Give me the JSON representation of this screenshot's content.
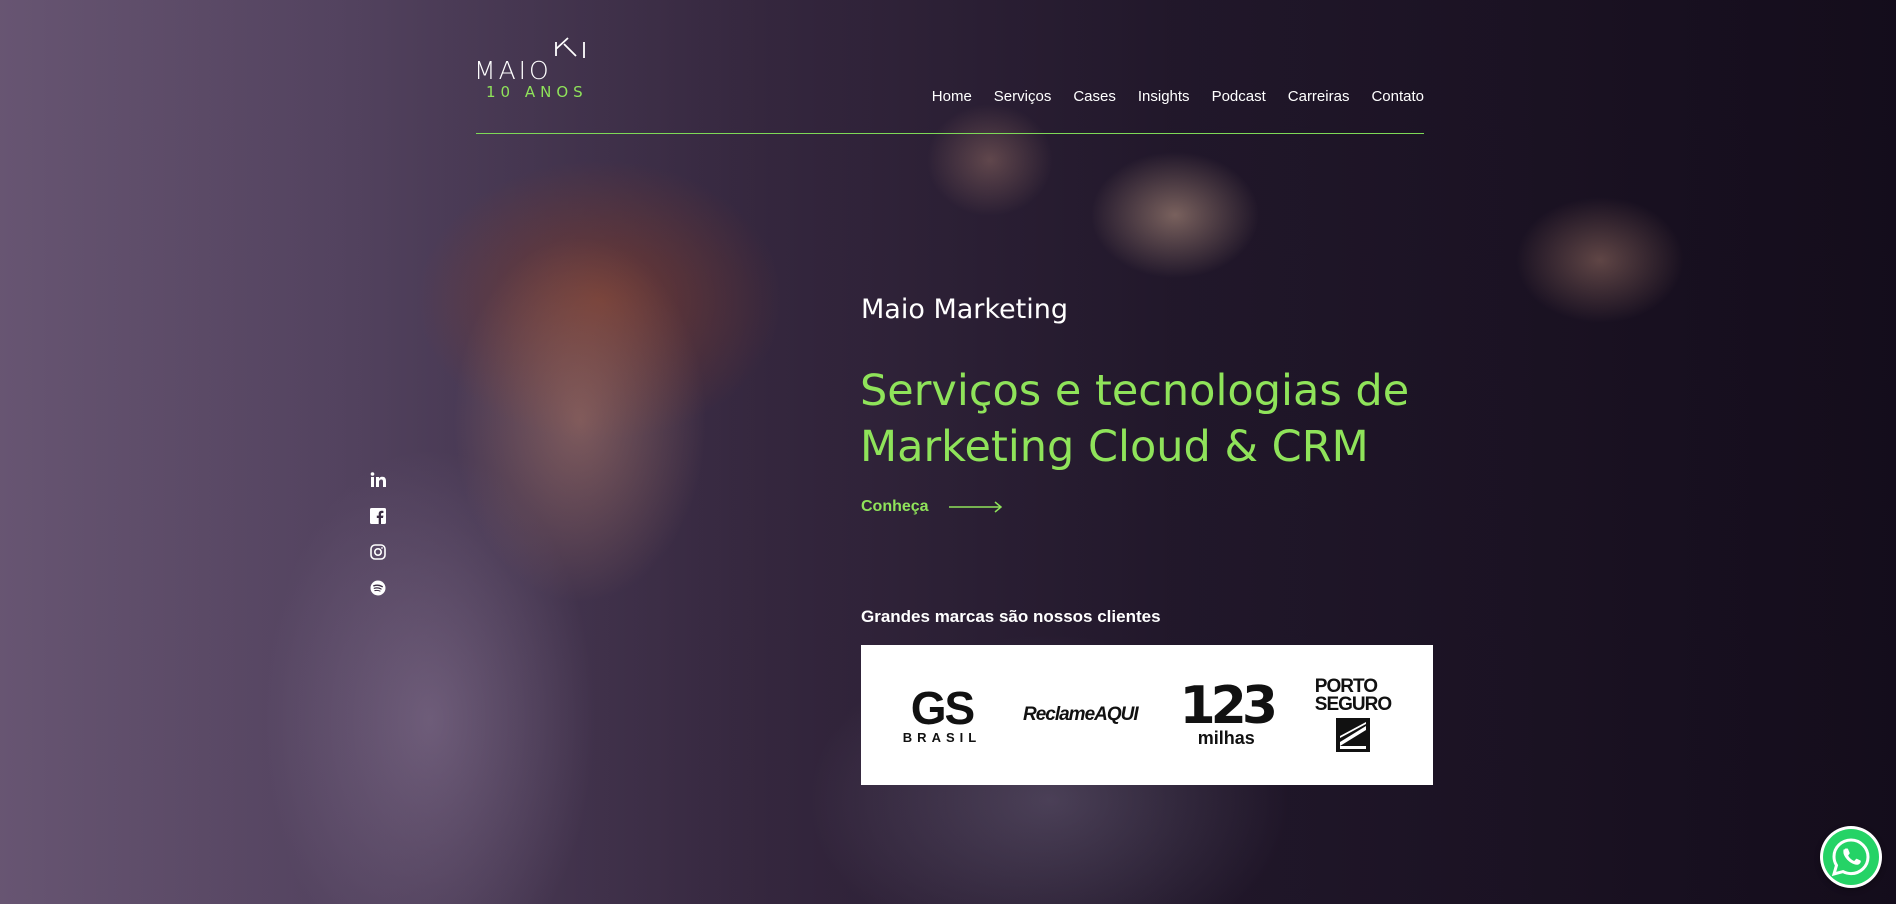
{
  "brand": {
    "logo_text": "MAIO",
    "logo_sub": "10 ANOS",
    "accent_color": "#8fe35a"
  },
  "nav": {
    "items": [
      {
        "label": "Home"
      },
      {
        "label": "Serviços"
      },
      {
        "label": "Cases"
      },
      {
        "label": "Insights"
      },
      {
        "label": "Podcast"
      },
      {
        "label": "Carreiras"
      },
      {
        "label": "Contato"
      }
    ]
  },
  "social": {
    "icons": [
      "linkedin-icon",
      "facebook-icon",
      "instagram-icon",
      "spotify-icon"
    ]
  },
  "hero": {
    "eyebrow": "Maio Marketing",
    "headline": "Serviços e tecnologias de Marketing Cloud & CRM",
    "cta_label": "Conheça"
  },
  "clients": {
    "title": "Grandes marcas são nossos clientes",
    "logos": {
      "gs_main": "GS",
      "gs_sub": "BRASIL",
      "reclame": "ReclameAQUI",
      "milhas_num": "123",
      "milhas_sub": "milhas",
      "porto_line1": "PORTO",
      "porto_line2": "SEGURO"
    }
  },
  "whatsapp": {
    "icon": "whatsapp-icon",
    "color": "#25d366"
  }
}
